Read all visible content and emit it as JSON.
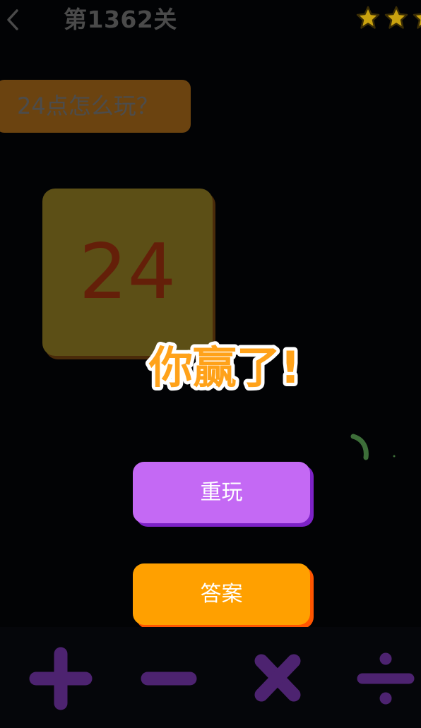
{
  "header": {
    "back_icon": "chevron-left-icon",
    "level_title": "第1362关",
    "stars": {
      "icon": "star-icon",
      "color": "#c9a20f",
      "visible_count": 3
    }
  },
  "help": {
    "label": "24点怎么玩？"
  },
  "target": {
    "value": "24"
  },
  "result": {
    "message": "你赢了!"
  },
  "actions": {
    "replay_label": "重玩",
    "answer_label": "答案"
  },
  "operators": [
    {
      "symbol": "+",
      "icon": "plus-icon"
    },
    {
      "symbol": "−",
      "icon": "minus-icon"
    },
    {
      "symbol": "×",
      "icon": "multiply-icon"
    },
    {
      "symbol": "÷",
      "icon": "divide-icon"
    }
  ],
  "colors": {
    "background": "#020305",
    "replay_button": "#c469f4",
    "answer_button": "#ffa000",
    "win_text_fill": "#ffa21a",
    "operator": "#4d2370"
  }
}
